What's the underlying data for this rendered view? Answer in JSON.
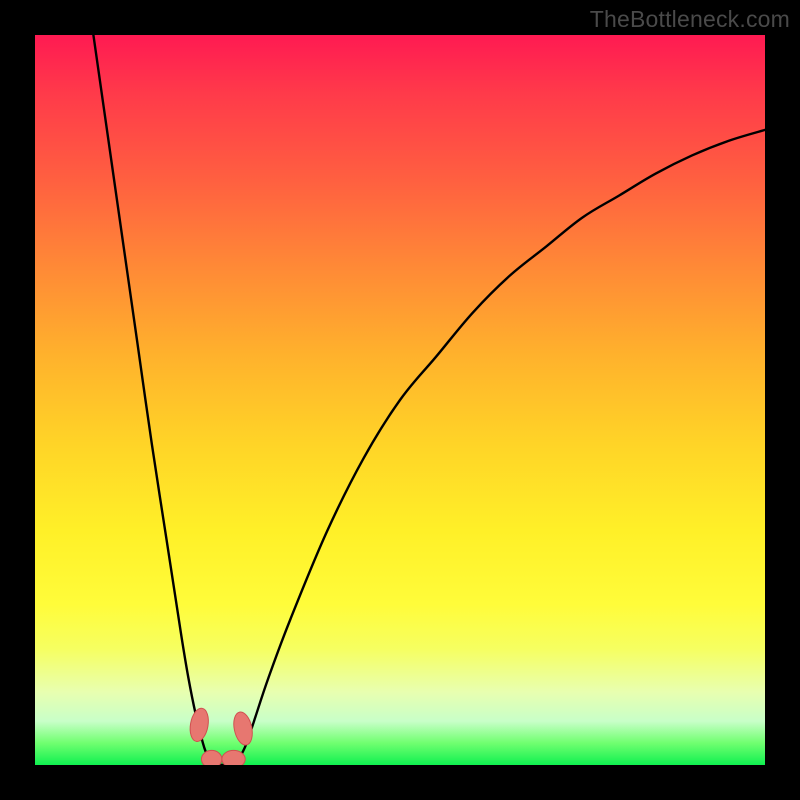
{
  "watermark": "TheBottleneck.com",
  "colors": {
    "background": "#000000",
    "gradient_top": "#ff1a52",
    "gradient_bottom": "#10f050",
    "curve_stroke": "#000000",
    "marker_fill": "#e77770",
    "marker_stroke": "#d05050"
  },
  "chart_data": {
    "type": "line",
    "title": "",
    "xlabel": "",
    "ylabel": "",
    "xlim": [
      0,
      100
    ],
    "ylim": [
      0,
      100
    ],
    "series": [
      {
        "name": "left-curve",
        "x": [
          8,
          10,
          12,
          14,
          16,
          18,
          20,
          21,
          22,
          23,
          23.5,
          24,
          25,
          26
        ],
        "y": [
          100,
          86,
          72,
          58,
          44,
          31,
          18,
          12,
          7,
          3,
          1.5,
          0,
          0,
          0
        ]
      },
      {
        "name": "right-curve",
        "x": [
          26,
          27,
          28,
          29,
          30,
          32,
          35,
          40,
          45,
          50,
          55,
          60,
          65,
          70,
          75,
          80,
          85,
          90,
          95,
          100
        ],
        "y": [
          0,
          0,
          1,
          3,
          6,
          12,
          20,
          32,
          42,
          50,
          56,
          62,
          67,
          71,
          75,
          78,
          81,
          83.5,
          85.5,
          87
        ]
      }
    ],
    "markers": [
      {
        "name": "left-top-marker",
        "cx": 22.5,
        "cy": 5.5,
        "rx": 1.2,
        "ry": 2.3,
        "rot": 10
      },
      {
        "name": "right-top-marker",
        "cx": 28.5,
        "cy": 5.0,
        "rx": 1.2,
        "ry": 2.3,
        "rot": -12
      },
      {
        "name": "bottom-left-marker",
        "cx": 24.2,
        "cy": 0.8,
        "rx": 1.4,
        "ry": 1.2,
        "rot": 0
      },
      {
        "name": "bottom-right-marker",
        "cx": 27.2,
        "cy": 0.8,
        "rx": 1.6,
        "ry": 1.2,
        "rot": 0
      }
    ]
  }
}
